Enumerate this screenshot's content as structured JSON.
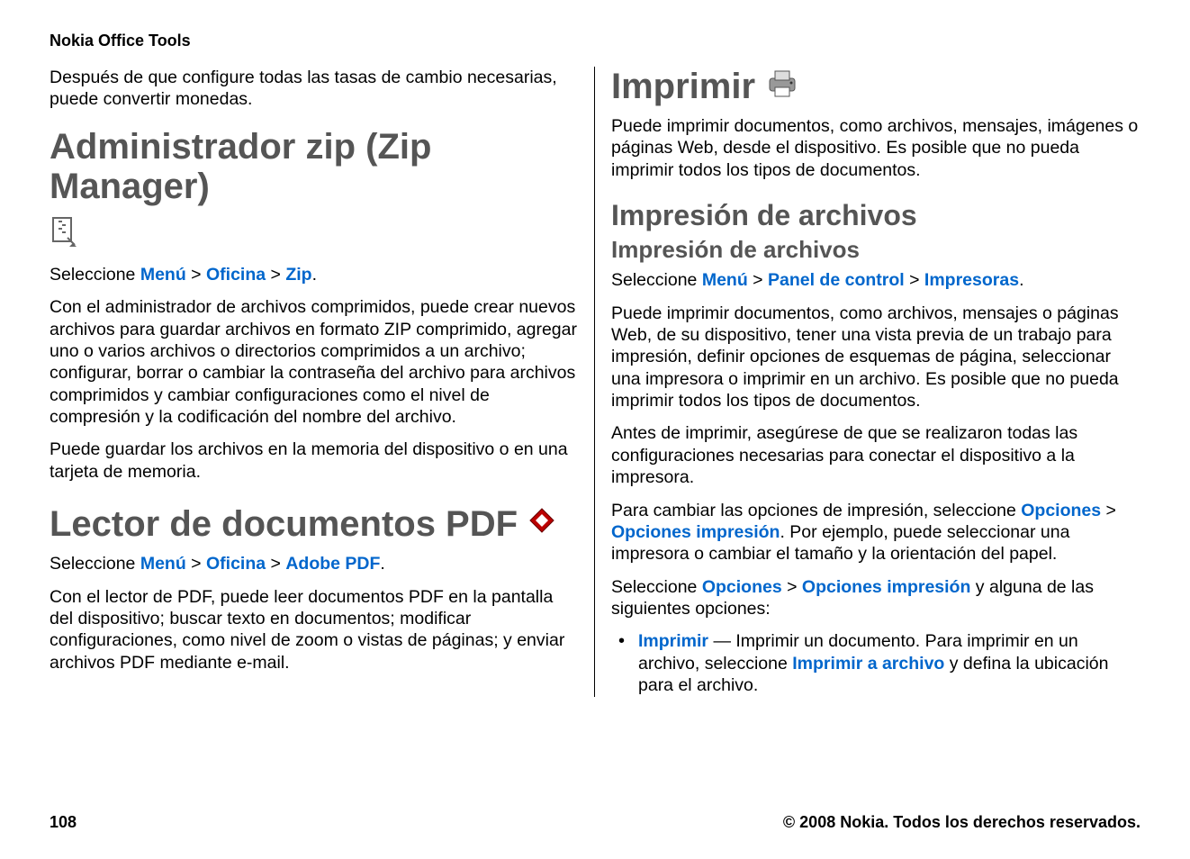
{
  "header": "Nokia Office Tools",
  "left": {
    "intro": "Después de que configure todas las tasas de cambio necesarias, puede convertir monedas.",
    "zip": {
      "title": "Administrador zip (Zip Manager)",
      "select_prefix": "Seleccione ",
      "menu": "Menú",
      "oficina": "Oficina",
      "zip": "Zip",
      "p1": "Con el administrador de archivos comprimidos, puede crear nuevos archivos para guardar archivos en formato ZIP comprimido, agregar uno o varios archivos o directorios comprimidos a un archivo; configurar, borrar o cambiar la contraseña del archivo para archivos comprimidos y cambiar configuraciones como el nivel de compresión y la codificación del nombre del archivo.",
      "p2": "Puede guardar los archivos en la memoria del dispositivo o en una tarjeta de memoria."
    },
    "pdf": {
      "title": "Lector de documentos PDF",
      "select_prefix": "Seleccione ",
      "menu": "Menú",
      "oficina": "Oficina",
      "adobe": "Adobe PDF",
      "p1": "Con el lector de PDF, puede leer documentos PDF en la pantalla del dispositivo; buscar texto en documentos; modificar configuraciones, como nivel de zoom o vistas de páginas; y enviar archivos PDF mediante e-mail."
    }
  },
  "right": {
    "print": {
      "title": "Imprimir",
      "p1": "Puede imprimir documentos, como archivos, mensajes, imágenes o páginas Web, desde el dispositivo. Es posible que no pueda imprimir todos los tipos de documentos."
    },
    "files": {
      "h2": "Impresión de archivos",
      "h3": "Impresión de archivos",
      "select_prefix": "Seleccione ",
      "menu": "Menú",
      "panel": "Panel de control",
      "impresoras": "Impresoras",
      "p1": "Puede imprimir documentos, como archivos, mensajes o páginas Web, de su dispositivo, tener una vista previa de un trabajo para impresión, definir opciones de esquemas de página, seleccionar una impresora o imprimir en un archivo. Es posible que no pueda imprimir todos los tipos de documentos.",
      "p2": "Antes de imprimir, asegúrese de que se realizaron todas las configuraciones necesarias para conectar el dispositivo a la impresora.",
      "p3a": "Para cambiar las opciones de impresión, seleccione ",
      "opciones": "Opciones",
      "opcimp": "Opciones impresión",
      "p3b": ". Por ejemplo, puede seleccionar una impresora o cambiar el tamaño y la orientación del papel.",
      "p4a": "Seleccione ",
      "p4b": " y alguna de las siguientes opciones:",
      "li_imprimir": "Imprimir",
      "li_text_a": " — Imprimir un documento. Para imprimir en un archivo, seleccione ",
      "li_imprimir_archivo": "Imprimir a archivo",
      "li_text_b": " y defina la ubicación para el archivo."
    }
  },
  "footer": {
    "page": "108",
    "copyright": "© 2008 Nokia. Todos los derechos reservados."
  },
  "sep": " > "
}
